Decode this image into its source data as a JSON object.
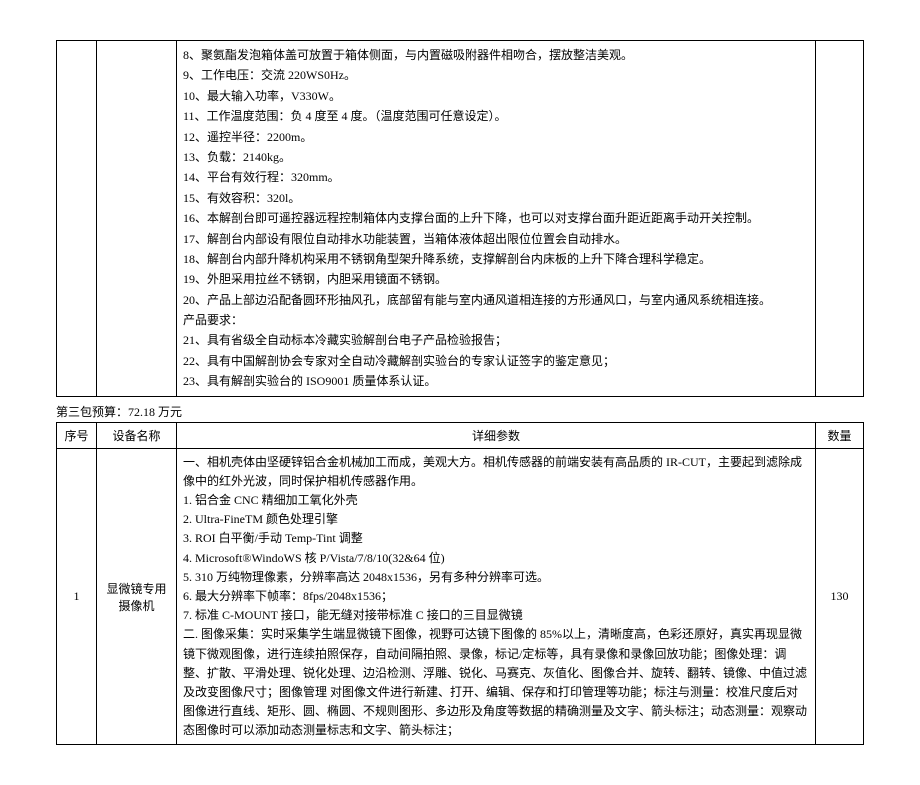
{
  "top_spec_lines": [
    "8、聚氨酯发泡箱体盖可放置于箱体侧面，与内置磁吸附器件相吻合，摆放整洁美观。",
    "9、工作电压：交流 220WS0Hz。",
    "10、最大输入功率，V330W。",
    "11、工作温度范围：负 4 度至 4 度。（温度范围可任意设定）。",
    "12、遥控半径：2200m。",
    "13、负载：2140kg。",
    "14、平台有效行程：320mm。",
    "15、有效容积：320l。",
    "16、本解剖台即可遥控器远程控制箱体内支撑台面的上升下降，也可以对支撑台面升距近距离手动开关控制。",
    "17、解剖台内部设有限位自动排水功能装置，当箱体液体超出限位位置会自动排水。",
    "18、解剖台内部升降机构采用不锈钢角型架升降系统，支撑解剖台内床板的上升下降合理科学稳定。",
    "19、外胆采用拉丝不锈钢，内胆采用镜面不锈钢。",
    "20、产品上部边沿配备圆环形抽风孔，底部留有能与室内通风道相连接的方形通风口，与室内通风系统相连接。",
    "产品要求：",
    "21、具有省级全自动标本冷藏实验解剖台电子产品检验报告；",
    "22、具有中国解剖协会专家对全自动冷藏解剖实验台的专家认证签字的鉴定意见；",
    "23、具有解剖实验台的 ISO9001 质量体系认证。"
  ],
  "budget_line": "第三包预算：72.18 万元",
  "headers": {
    "index": "序号",
    "name": "设备名称",
    "spec": "详细参数",
    "qty": "数量"
  },
  "row1": {
    "index": "1",
    "name": "显微镜专用摄像机",
    "qty": "130",
    "spec_lines": [
      "一、相机壳体由坚硬锌铝合金机械加工而成，美观大方。相机传感器的前端安装有高品质的 IR-CUT，主要起到滤除成像中的红外光波，同时保护相机传感器作用。",
      "1. 铝合金 CNC 精细加工氧化外壳",
      "2. Ultra-FineTM 颜色处理引擎",
      "3. ROI 白平衡/手动 Temp-Tint 调整",
      "4. Microsoft®WindoWS 核 P/Vista/7/8/10(32&64 位)",
      "5. 310 万纯物理像素，分辨率高达 2048x1536，另有多种分辨率可选。",
      "6. 最大分辨率下帧率：8fps/2048x1536；",
      "7. 标准 C-MOUNT 接口，能无缝对接带标准 C 接口的三目显微镜",
      "二. 图像采集：实时采集学生端显微镜下图像，视野可达镜下图像的 85%以上，清晰度高，色彩还原好，真实再现显微镜下微观图像，进行连续拍照保存，自动间隔拍照、录像，标记/定标等，具有录像和录像回放功能；图像处理：调整、扩散、平滑处理、锐化处理、边沿检测、浮雕、锐化、马赛克、灰值化、图像合并、旋转、翻转、镜像、中值过滤及改变图像尺寸；图像管理 对图像文件进行新建、打开、编辑、保存和打印管理等功能；标注与测量：校准尺度后对图像进行直线、矩形、圆、椭圆、不规则图形、多边形及角度等数据的精确测量及文字、箭头标注；动态测量：观察动态图像时可以添加动态测量标志和文字、箭头标注；"
    ]
  }
}
